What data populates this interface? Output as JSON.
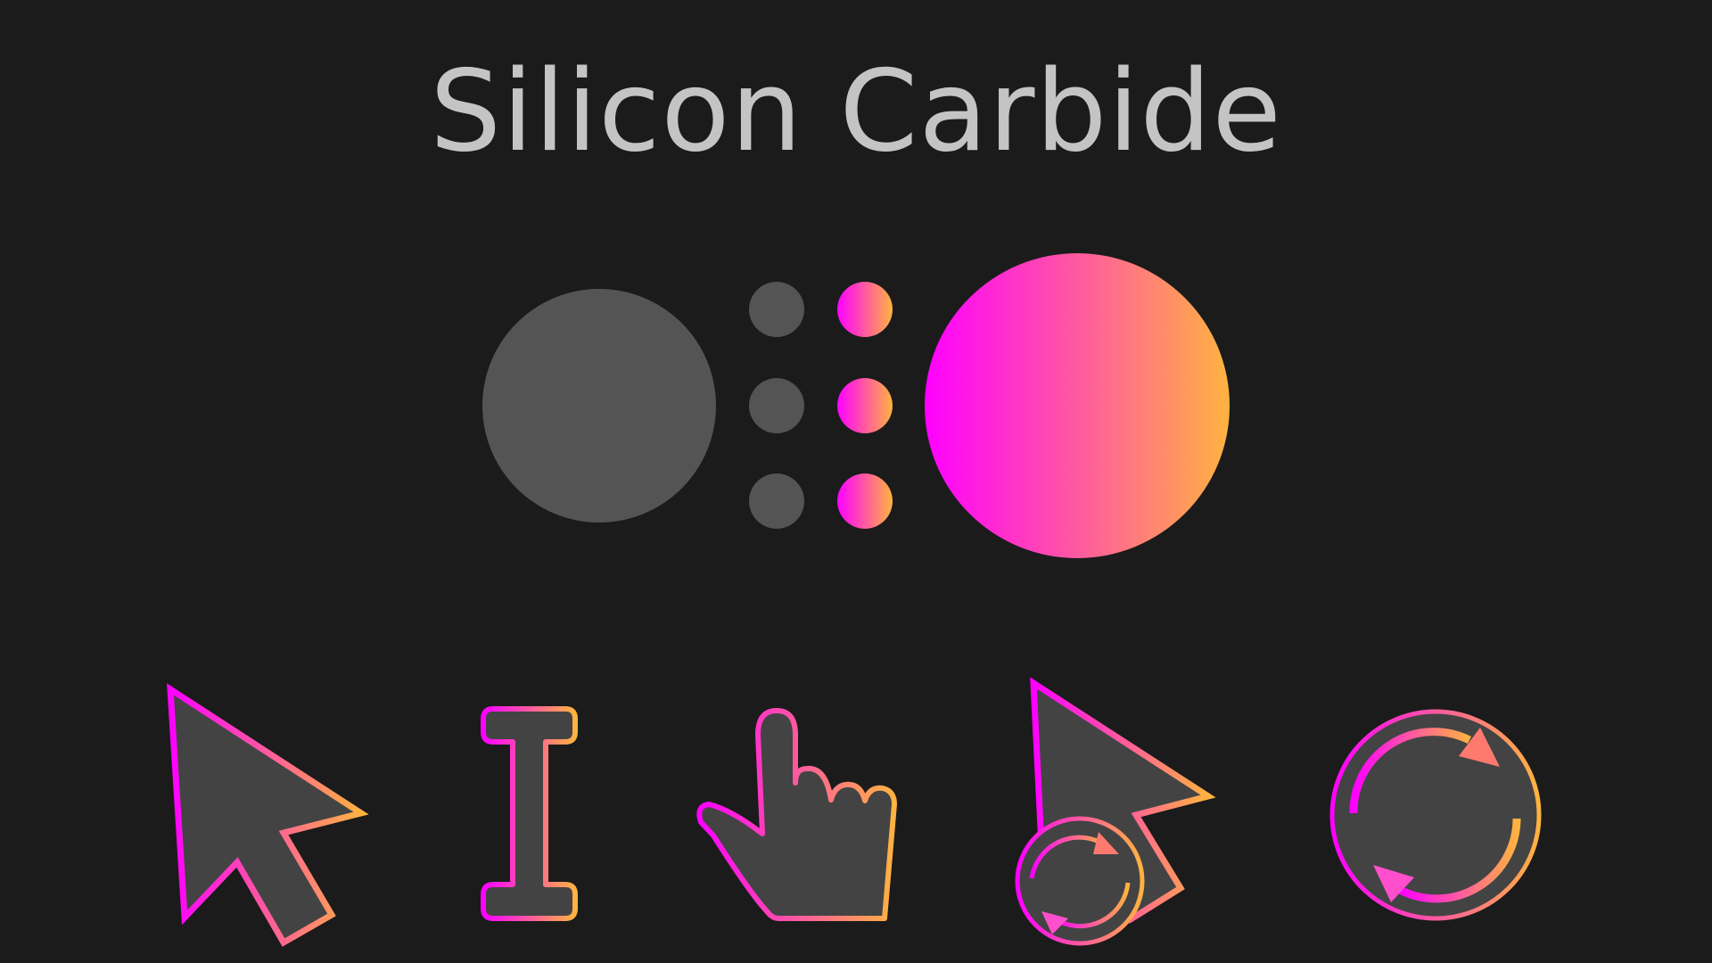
{
  "theme": {
    "title": "Silicon Carbide",
    "colors": {
      "background": "#1b1b1b",
      "title_text": "#c4c4c4",
      "neutral_fill": "#545454",
      "cursor_fill": "#434343",
      "gradient_start": "#ff00ff",
      "gradient_end": "#ffb340"
    }
  },
  "palette": {
    "large_swatches": [
      "neutral-gray",
      "magenta-orange-gradient"
    ],
    "small_dot_columns": [
      "neutral-gray",
      "magenta-orange-gradient"
    ],
    "dots_per_column": 3
  },
  "cursors": [
    {
      "name": "arrow-cursor-icon",
      "kind": "default pointer"
    },
    {
      "name": "text-beam-cursor-icon",
      "kind": "text / I-beam"
    },
    {
      "name": "hand-pointer-cursor-icon",
      "kind": "link pointer"
    },
    {
      "name": "busy-arrow-cursor-icon",
      "kind": "progress"
    },
    {
      "name": "wait-spinner-cursor-icon",
      "kind": "wait"
    }
  ]
}
